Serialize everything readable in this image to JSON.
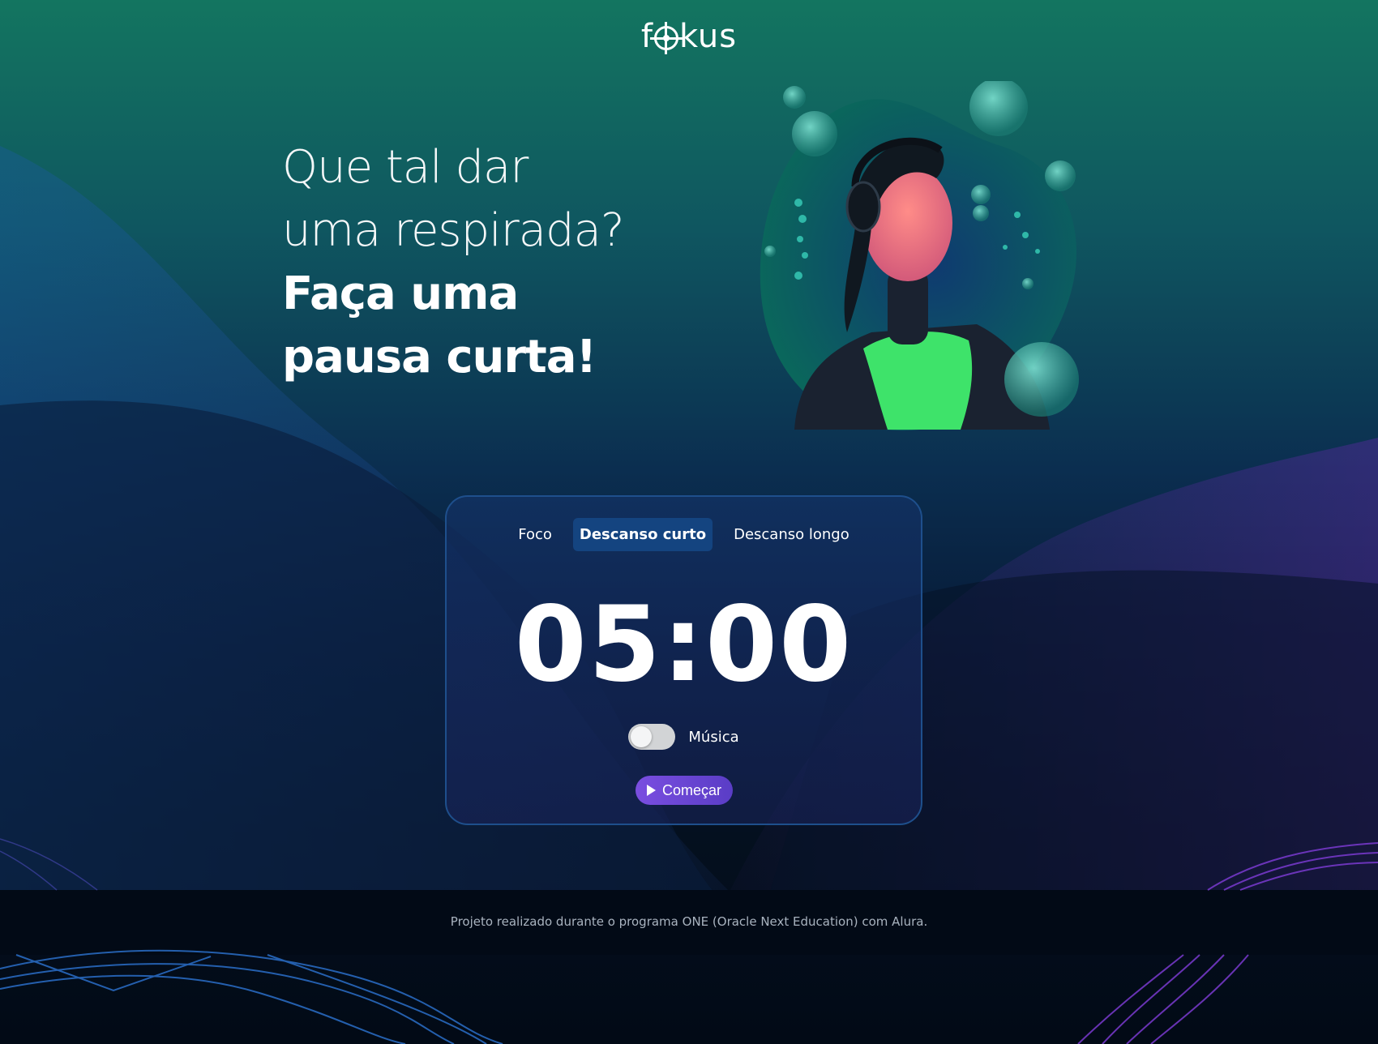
{
  "app": {
    "logo_text": "fokus"
  },
  "hero": {
    "line1": "Que tal dar",
    "line2": "uma respirada?",
    "line3": "Faça uma",
    "line4": "pausa curta!",
    "image_icon": "woman-with-headphones-bubbles"
  },
  "timer_card": {
    "tabs": [
      {
        "label": "Foco",
        "active": false
      },
      {
        "label": "Descanso curto",
        "active": true
      },
      {
        "label": "Descanso longo",
        "active": false
      }
    ],
    "time": "05:00",
    "music_label": "Música",
    "music_on": false,
    "start_label": "Começar",
    "start_icon": "play-icon"
  },
  "footer": {
    "text": "Projeto realizado durante o programa ONE (Oracle Next Education) com Alura."
  },
  "colors": {
    "accent_purple": "#6b45d8",
    "active_tab": "#144480",
    "card_border": "#1e4f8c"
  }
}
